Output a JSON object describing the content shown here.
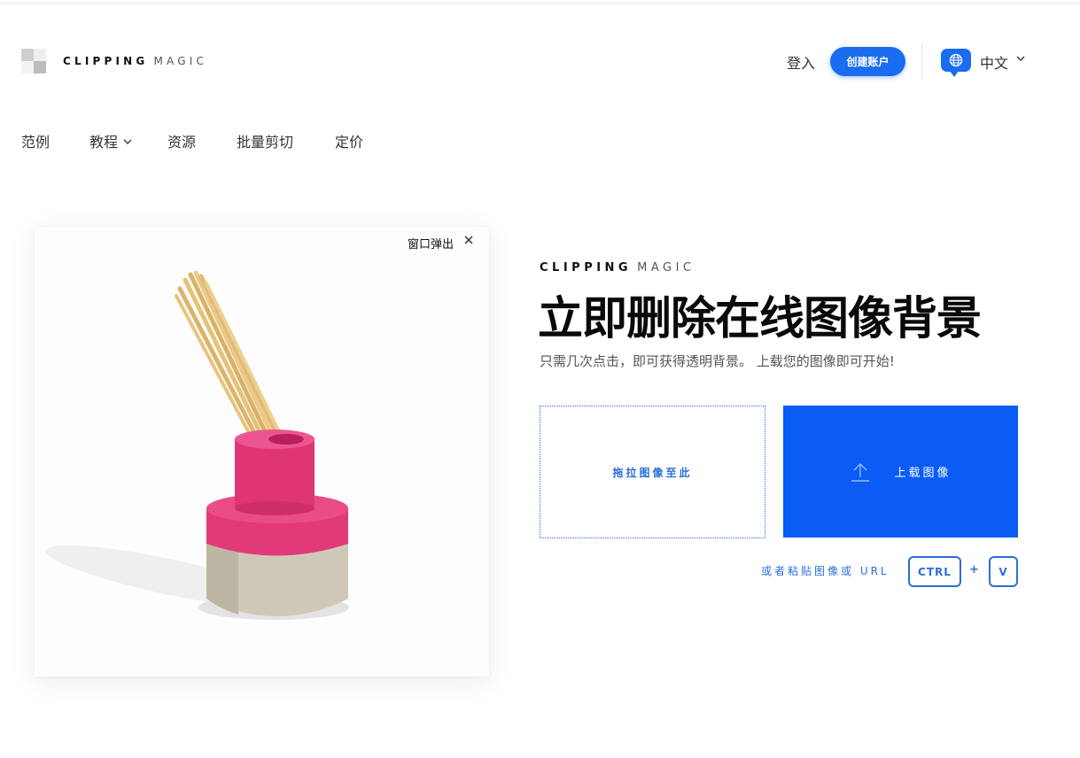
{
  "header": {
    "brand_bold": "CLIPPING",
    "brand_light": "MAGIC",
    "login_label": "登入",
    "signup_label": "创建账户",
    "language_label": "中文",
    "accent_color": "#1a6cf0"
  },
  "nav": {
    "items": [
      {
        "label": "范例"
      },
      {
        "label": "教程",
        "has_dropdown": true
      },
      {
        "label": "资源"
      },
      {
        "label": "批量剪切"
      },
      {
        "label": "定价"
      }
    ]
  },
  "sample_card": {
    "popout_label": "窗口弹出",
    "close_icon": "close-icon",
    "image_subject": "pink and concrete vase with wooden sticks"
  },
  "hero": {
    "brand_bold": "CLIPPING",
    "brand_light": "MAGIC",
    "headline": "立即删除在线图像背景",
    "subtitle": "只需几次点击，即可获得透明背景。 上载您的图像即可开始!",
    "dropzone_label": "拖拉图像至此",
    "upload_label": "上载图像",
    "upload_icon": "upload-arrow-icon",
    "paste_hint": "或者粘贴图像或 URL",
    "key_ctrl": "CTRL",
    "key_plus": "+",
    "key_v": "V",
    "upload_color": "#0a5cf5"
  }
}
